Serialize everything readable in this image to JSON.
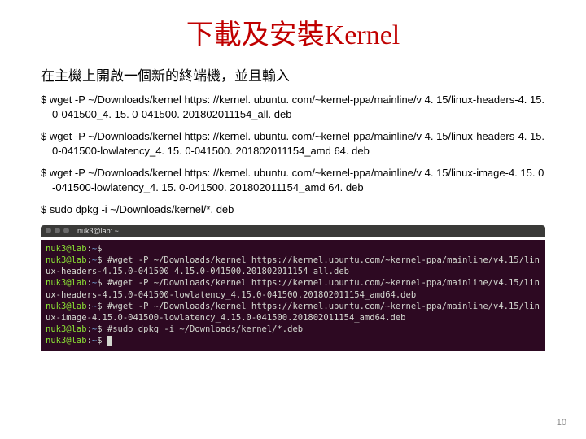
{
  "title_cjk": "下載及安裝",
  "title_latin": "Kernel",
  "subtitle": "在主機上開啟一個新的終端機，並且輸入",
  "commands": [
    "$ wget -P ~/Downloads/kernel https: //kernel. ubuntu. com/~kernel-ppa/mainline/v 4. 15/linux-headers-4. 15. 0-041500_4. 15. 0-041500. 201802011154_all. deb",
    "$ wget -P ~/Downloads/kernel https: //kernel. ubuntu. com/~kernel-ppa/mainline/v 4. 15/linux-headers-4. 15. 0-041500-lowlatency_4. 15. 0-041500. 201802011154_amd 64. deb",
    "$ wget -P ~/Downloads/kernel https: //kernel. ubuntu. com/~kernel-ppa/mainline/v 4. 15/linux-image-4. 15. 0-041500-lowlatency_4. 15. 0-041500. 201802011154_amd 64. deb",
    "$ sudo dpkg -i ~/Downloads/kernel/*. deb"
  ],
  "terminal_title": "nuk3@lab: ~",
  "terminal_lines": [
    {
      "prompt": "nuk3@lab",
      "path": "~",
      "text": "$ "
    },
    {
      "prompt": "nuk3@lab",
      "path": "~",
      "text": "$ #wget -P ~/Downloads/kernel https://kernel.ubuntu.com/~kernel-ppa/mainline/v4.15/linux-headers-4.15.0-041500_4.15.0-041500.201802011154_all.deb"
    },
    {
      "prompt": "nuk3@lab",
      "path": "~",
      "text": "$ #wget -P ~/Downloads/kernel https://kernel.ubuntu.com/~kernel-ppa/mainline/v4.15/linux-headers-4.15.0-041500-lowlatency_4.15.0-041500.201802011154_amd64.deb"
    },
    {
      "prompt": "nuk3@lab",
      "path": "~",
      "text": "$ #wget -P ~/Downloads/kernel https://kernel.ubuntu.com/~kernel-ppa/mainline/v4.15/linux-image-4.15.0-041500-lowlatency_4.15.0-041500.201802011154_amd64.deb"
    },
    {
      "prompt": "nuk3@lab",
      "path": "~",
      "text": "$ #sudo dpkg -i ~/Downloads/kernel/*.deb"
    },
    {
      "prompt": "nuk3@lab",
      "path": "~",
      "text": "$ ",
      "cursor": true
    }
  ],
  "page_number": "10"
}
